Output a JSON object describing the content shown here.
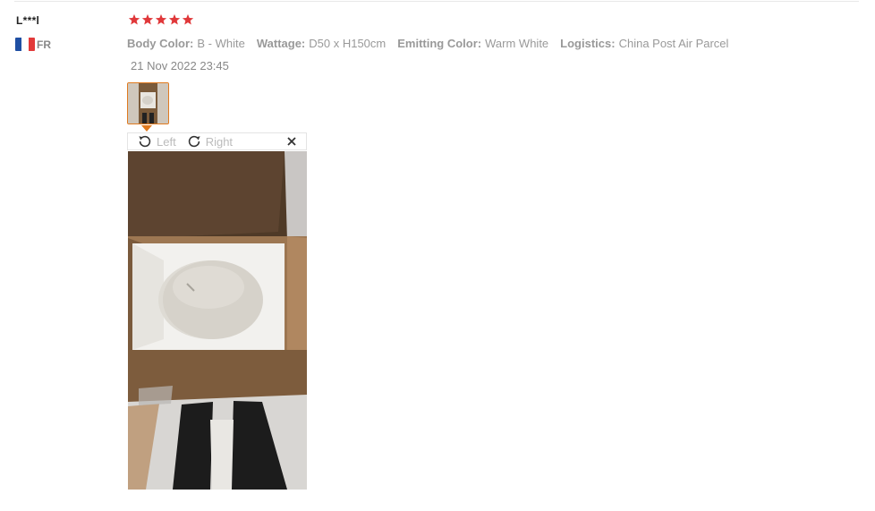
{
  "review": {
    "user_name": "L***l",
    "country_code": "FR",
    "rating": 5,
    "properties": [
      {
        "key": "Body Color:",
        "value": "B - White"
      },
      {
        "key": "Wattage:",
        "value": "D50 x H150cm"
      },
      {
        "key": "Emitting Color:",
        "value": "Warm White"
      },
      {
        "key": "Logistics:",
        "value": "China Post Air Parcel"
      }
    ],
    "date": "21 Nov 2022 23:45"
  },
  "viewer": {
    "rotate_left_label": "Left",
    "rotate_right_label": "Right"
  },
  "icons": {
    "star": "star-icon",
    "rotate_left": "rotate-left-icon",
    "rotate_right": "rotate-right-icon",
    "close": "close-icon"
  },
  "colors": {
    "star": "#e0383a",
    "thumb_border": "#e07a1f",
    "flag_blue": "#1f4fa3",
    "flag_red": "#e23a3a"
  }
}
